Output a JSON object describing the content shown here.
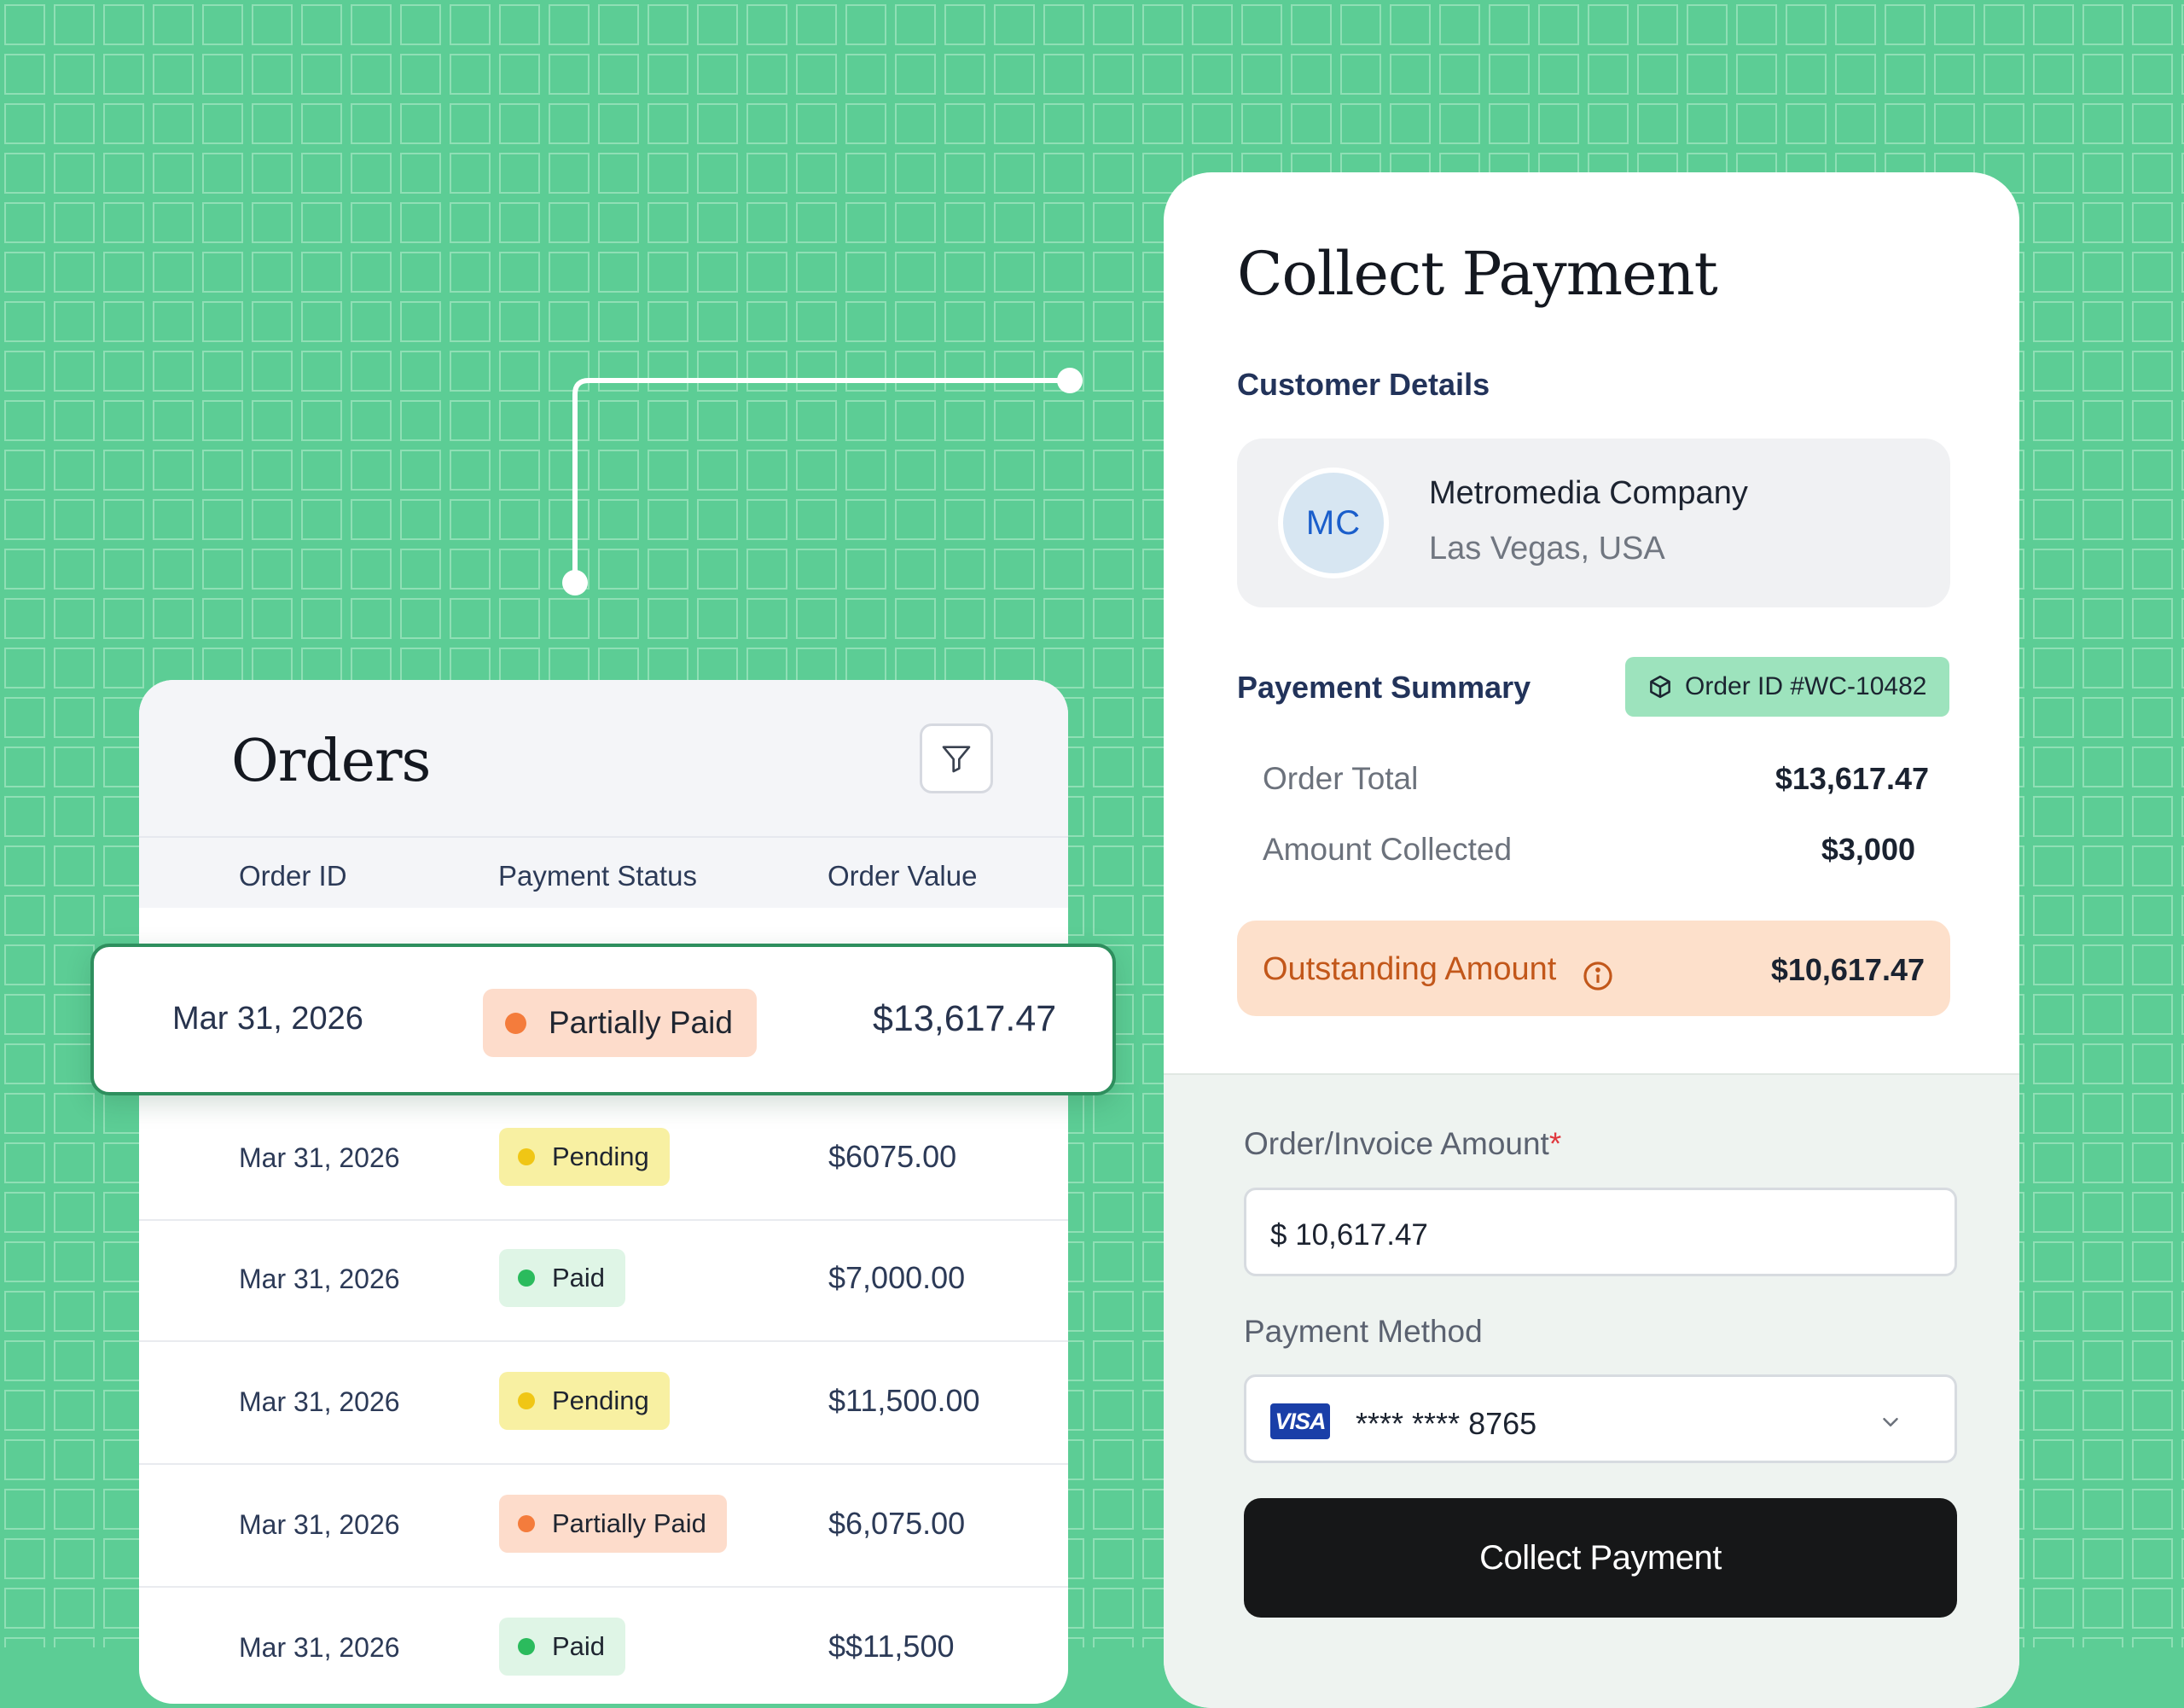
{
  "colors": {
    "background": "#5ccd95",
    "grid_line": "#8fdfb5",
    "accent_green": "#2e8f5e",
    "outstanding_bg": "#fde0cb",
    "outstanding_text": "#c2571a",
    "button_bg": "#161718"
  },
  "orders": {
    "title": "Orders",
    "filter_icon": "filter-icon",
    "columns": [
      "Order ID",
      "Payment Status",
      "Order Value"
    ],
    "highlighted": {
      "date": "Mar 31, 2026",
      "status": "Partially Paid",
      "value": "$13,617.47"
    },
    "rows": [
      {
        "date": "Mar 31, 2026",
        "status": "Pending",
        "value": "$6075.00"
      },
      {
        "date": "Mar 31, 2026",
        "status": "Paid",
        "value": "$7,000.00"
      },
      {
        "date": "Mar 31, 2026",
        "status": "Pending",
        "value": "$11,500.00"
      },
      {
        "date": "Mar 31, 2026",
        "status": "Partially Paid",
        "value": "$6,075.00"
      },
      {
        "date": "Mar 31, 2026",
        "status": "Paid",
        "value": "$$11,500"
      }
    ]
  },
  "payment": {
    "title": "Collect Payment",
    "customer_heading": "Customer Details",
    "customer": {
      "initials": "MC",
      "name": "Metromedia Company",
      "location": "Las Vegas, USA"
    },
    "summary_heading": "Payement Summary",
    "order_badge": "Order ID #WC-10482",
    "order_total_label": "Order Total",
    "order_total": "$13,617.47",
    "amount_collected_label": "Amount Collected",
    "amount_collected": "$3,000",
    "outstanding_label": "Outstanding Amount",
    "outstanding": "$10,617.47",
    "invoice_label": "Order/Invoice Amount",
    "required_mark": "*",
    "invoice_value": "$ 10,617.47",
    "method_label": "Payment Method",
    "card_brand": "VISA",
    "card_number": "**** **** 8765",
    "button": "Collect Payment"
  }
}
